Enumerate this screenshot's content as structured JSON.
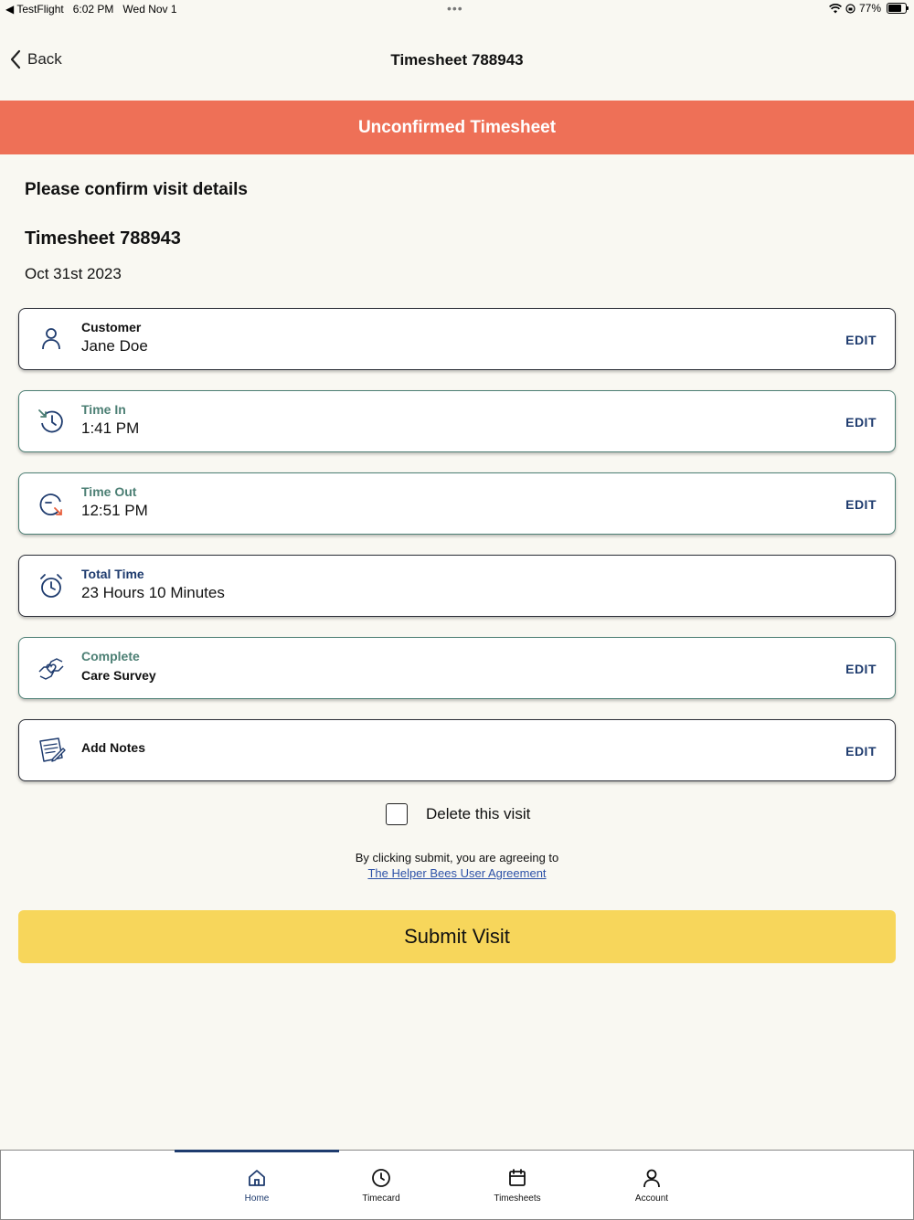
{
  "status_bar": {
    "app": "TestFlight",
    "time": "6:02 PM",
    "date": "Wed Nov 1",
    "battery": "77%"
  },
  "nav": {
    "back_label": "Back",
    "title": "Timesheet 788943"
  },
  "banner": "Unconfirmed Timesheet",
  "confirm_heading": "Please confirm visit details",
  "timesheet_heading": "Timesheet 788943",
  "visit_date": "Oct 31st 2023",
  "cards": {
    "customer": {
      "label": "Customer",
      "value": "Jane Doe",
      "edit": "EDIT"
    },
    "time_in": {
      "label": "Time In",
      "value": "1:41 PM",
      "edit": "EDIT"
    },
    "time_out": {
      "label": "Time Out",
      "value": "12:51 PM",
      "edit": "EDIT"
    },
    "total_time": {
      "label": "Total Time",
      "value": "23 Hours 10 Minutes"
    },
    "care_survey": {
      "label": "Complete",
      "value": "Care Survey",
      "edit": "EDIT"
    },
    "notes": {
      "label": "Add Notes",
      "edit": "EDIT"
    }
  },
  "delete_visit_label": "Delete this visit",
  "agreement": {
    "text": "By clicking submit, you are agreeing to",
    "link": "The Helper Bees User Agreement"
  },
  "submit_label": "Submit Visit",
  "tabs": [
    {
      "label": "Home",
      "icon": "home-icon",
      "active": true
    },
    {
      "label": "Timecard",
      "icon": "clock-icon"
    },
    {
      "label": "Timesheets",
      "icon": "calendar-icon"
    },
    {
      "label": "Account",
      "icon": "person-icon"
    }
  ],
  "colors": {
    "banner": "#ee7057",
    "accent_blue": "#1e3b6e",
    "accent_green": "#4c7f74",
    "submit": "#f7d65b",
    "background": "#f9f8f2"
  }
}
